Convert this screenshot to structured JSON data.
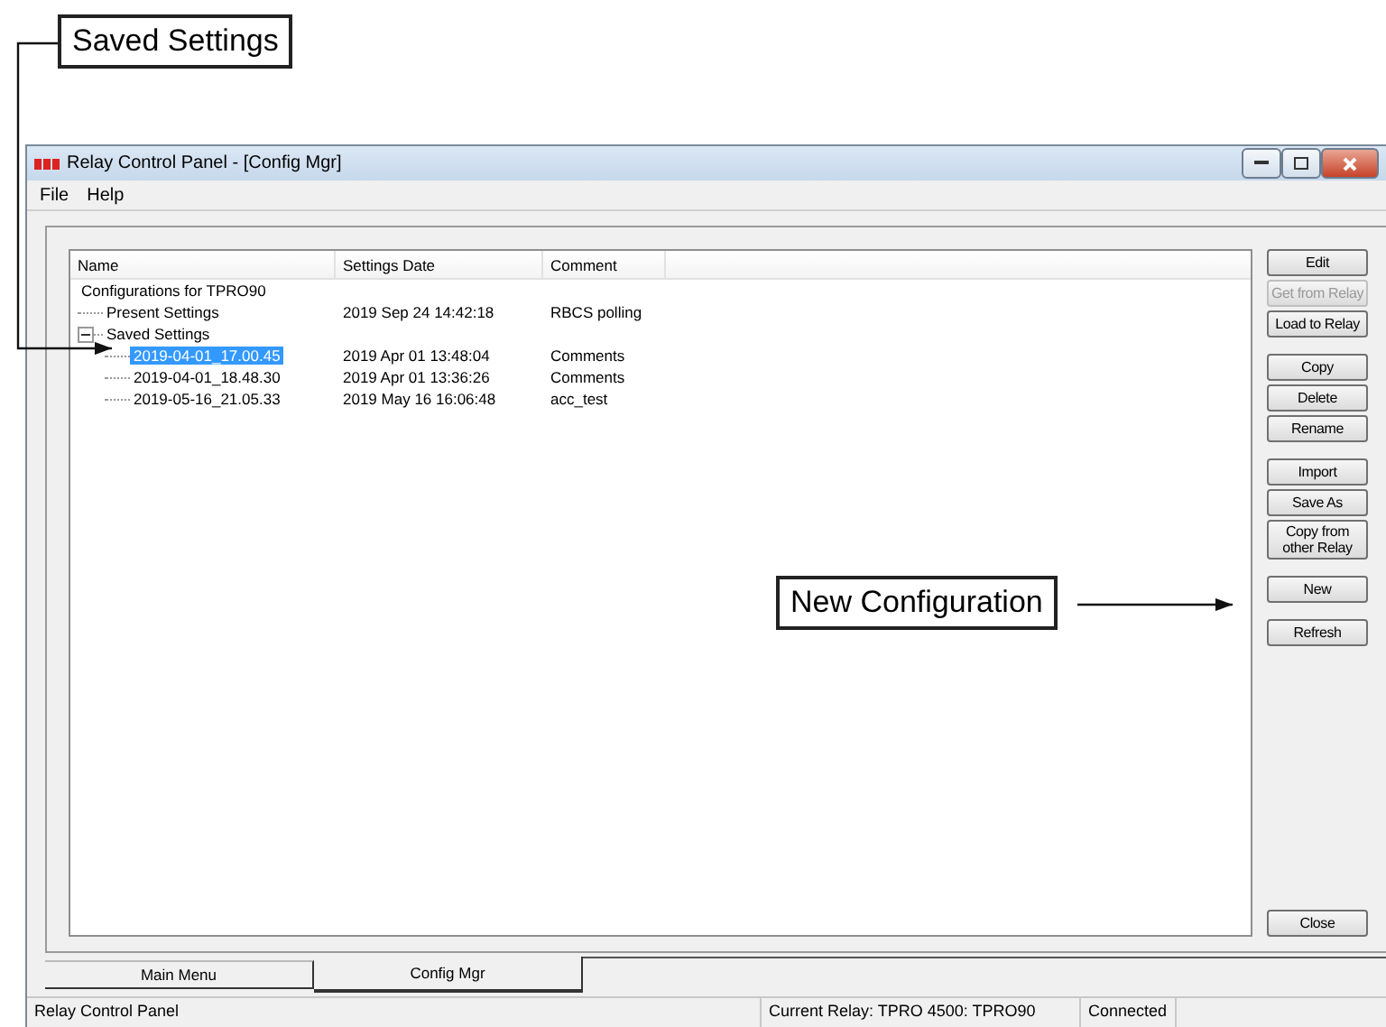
{
  "callouts": [
    {
      "text": "Saved Settings"
    },
    {
      "text": "New Configuration"
    }
  ],
  "window": {
    "title": "Relay Control Panel - [Config Mgr]"
  },
  "menu": [
    "File",
    "Help"
  ],
  "table": {
    "columns": [
      "Name",
      "Settings Date",
      "Comment"
    ],
    "tree": {
      "name": "Configurations for TPRO90",
      "children": [
        {
          "name": "Present Settings",
          "date": "2019 Sep 24 14:42:18",
          "comment": "RBCS polling",
          "selected": false
        },
        {
          "name": "Saved Settings",
          "expanded": true,
          "selected": false,
          "children": [
            {
              "name": "2019-04-01_17.00.45",
              "date": "2019 Apr 01 13:48:04",
              "comment": "Comments",
              "selected": true
            },
            {
              "name": "2019-04-01_18.48.30",
              "date": "2019 Apr 01 13:36:26",
              "comment": "Comments",
              "selected": false
            },
            {
              "name": "2019-05-16_21.05.33",
              "date": "2019 May 16 16:06:48",
              "comment": "acc_test",
              "selected": false
            }
          ]
        }
      ]
    }
  },
  "button_groups": [
    [
      {
        "label": "Edit",
        "disabled": false
      },
      {
        "label": "Get from Relay",
        "disabled": true
      },
      {
        "label": "Load to Relay",
        "disabled": false
      }
    ],
    [
      {
        "label": "Copy",
        "disabled": false
      },
      {
        "label": "Delete",
        "disabled": false
      },
      {
        "label": "Rename",
        "disabled": false
      }
    ],
    [
      {
        "label": "Import",
        "disabled": false
      },
      {
        "label": "Save As",
        "disabled": false
      },
      {
        "label": "Copy from other Relay",
        "disabled": false
      }
    ],
    [
      {
        "label": "New",
        "disabled": false
      }
    ],
    [
      {
        "label": "Refresh",
        "disabled": false
      }
    ]
  ],
  "close_button": {
    "label": "Close"
  },
  "tabs": [
    {
      "label": "Main Menu",
      "selected": false
    },
    {
      "label": "Config Mgr",
      "selected": true
    }
  ],
  "status_bar": [
    "Relay Control Panel",
    "Current Relay: TPRO 4500: TPRO90",
    "Connected"
  ]
}
